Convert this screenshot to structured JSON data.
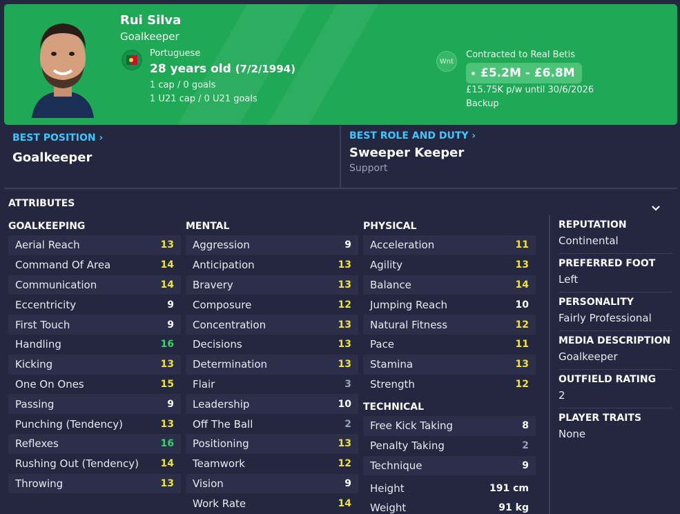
{
  "player": {
    "name": "Rui Silva",
    "position": "Goalkeeper",
    "nationality": "Portuguese",
    "age": "28 years old",
    "dob": "(7/2/1994)",
    "caps": "1 cap / 0 goals",
    "u21_caps": "1 U21 cap / 0 U21 goals"
  },
  "contract": {
    "wnt_badge": "Wnt",
    "status": "Contracted to Real Betis",
    "value": "£5.2M - £6.8M",
    "wage": "£15.75K p/w until 30/6/2026",
    "squad_status": "Backup"
  },
  "best_position": {
    "label": "BEST POSITION",
    "value": "Goalkeeper"
  },
  "best_role": {
    "label": "BEST ROLE AND DUTY",
    "value": "Sweeper Keeper",
    "duty": "Support"
  },
  "attributes_title": "ATTRIBUTES",
  "goalkeeping": {
    "title": "GOALKEEPING",
    "items": [
      {
        "name": "Aerial Reach",
        "value": "13"
      },
      {
        "name": "Command Of Area",
        "value": "14"
      },
      {
        "name": "Communication",
        "value": "14"
      },
      {
        "name": "Eccentricity",
        "value": "9"
      },
      {
        "name": "First Touch",
        "value": "9"
      },
      {
        "name": "Handling",
        "value": "16"
      },
      {
        "name": "Kicking",
        "value": "13"
      },
      {
        "name": "One On Ones",
        "value": "15"
      },
      {
        "name": "Passing",
        "value": "9"
      },
      {
        "name": "Punching (Tendency)",
        "value": "13"
      },
      {
        "name": "Reflexes",
        "value": "16"
      },
      {
        "name": "Rushing Out (Tendency)",
        "value": "14"
      },
      {
        "name": "Throwing",
        "value": "13"
      }
    ]
  },
  "mental": {
    "title": "MENTAL",
    "items": [
      {
        "name": "Aggression",
        "value": "9"
      },
      {
        "name": "Anticipation",
        "value": "13"
      },
      {
        "name": "Bravery",
        "value": "13"
      },
      {
        "name": "Composure",
        "value": "12"
      },
      {
        "name": "Concentration",
        "value": "13"
      },
      {
        "name": "Decisions",
        "value": "13"
      },
      {
        "name": "Determination",
        "value": "13"
      },
      {
        "name": "Flair",
        "value": "3"
      },
      {
        "name": "Leadership",
        "value": "10"
      },
      {
        "name": "Off The Ball",
        "value": "2"
      },
      {
        "name": "Positioning",
        "value": "13"
      },
      {
        "name": "Teamwork",
        "value": "12"
      },
      {
        "name": "Vision",
        "value": "9"
      },
      {
        "name": "Work Rate",
        "value": "14"
      }
    ]
  },
  "physical": {
    "title": "PHYSICAL",
    "items": [
      {
        "name": "Acceleration",
        "value": "11"
      },
      {
        "name": "Agility",
        "value": "13"
      },
      {
        "name": "Balance",
        "value": "14"
      },
      {
        "name": "Jumping Reach",
        "value": "10"
      },
      {
        "name": "Natural Fitness",
        "value": "12"
      },
      {
        "name": "Pace",
        "value": "11"
      },
      {
        "name": "Stamina",
        "value": "13"
      },
      {
        "name": "Strength",
        "value": "12"
      }
    ]
  },
  "technical": {
    "title": "TECHNICAL",
    "items": [
      {
        "name": "Free Kick Taking",
        "value": "8"
      },
      {
        "name": "Penalty Taking",
        "value": "2"
      },
      {
        "name": "Technique",
        "value": "9"
      }
    ]
  },
  "body": {
    "height_label": "Height",
    "height": "191 cm",
    "weight_label": "Weight",
    "weight": "91 kg"
  },
  "side": {
    "reputation_label": "REPUTATION",
    "reputation": "Continental",
    "foot_label": "PREFERRED FOOT",
    "foot": "Left",
    "personality_label": "PERSONALITY",
    "personality": "Fairly Professional",
    "media_label": "MEDIA DESCRIPTION",
    "media": "Goalkeeper",
    "outfield_label": "OUTFIELD RATING",
    "outfield": "2",
    "traits_label": "PLAYER TRAITS",
    "traits": "None"
  },
  "colors": {
    "header_green": "#1fa855",
    "background": "#242740",
    "accent_blue": "#3ec6ff",
    "value_white": "#ffffff",
    "value_grey": "#9aa0b5",
    "value_yellow": "#f0e23a",
    "value_green": "#35d46a"
  }
}
